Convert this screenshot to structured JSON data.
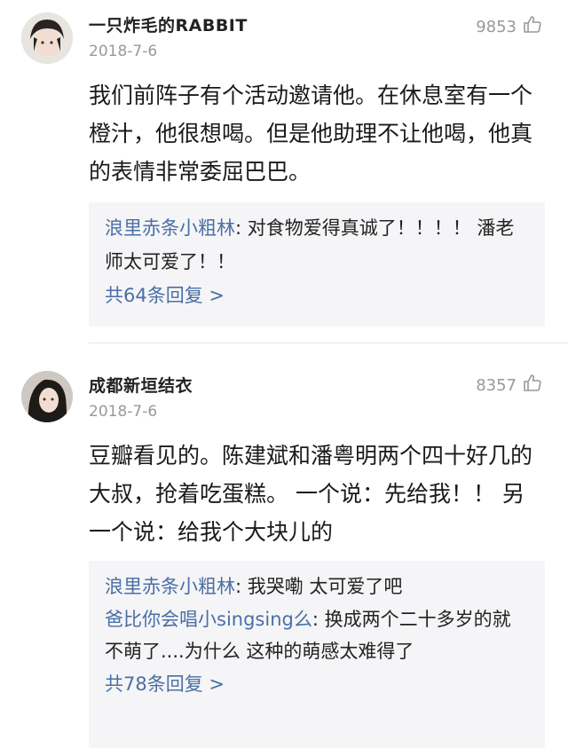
{
  "comments": [
    {
      "username": "一只炸毛的RABBIT",
      "date": "2018-7-6",
      "likes": "9853",
      "text": "我们前阵子有个活动邀请他。在休息室有一个橙汁，他很想喝。但是他助理不让他喝，他真的表情非常委屈巴巴。",
      "replies": [
        {
          "name": "浪里赤条小粗林",
          "text": ": 对食物爱得真诚了！！！！ 潘老师太可爱了！！"
        }
      ],
      "more": "共64条回复 >"
    },
    {
      "username": "成都新垣结衣",
      "date": "2018-7-6",
      "likes": "8357",
      "text": "豆瓣看见的。陈建斌和潘粤明两个四十好几的大叔，抢着吃蛋糕。 一个说：先给我！！ 另一个说：给我个大块儿的",
      "replies": [
        {
          "name": "浪里赤条小粗林",
          "text": ": 我哭嘞 太可爱了吧"
        },
        {
          "name": "爸比你会唱小singsing么",
          "text": ": 换成两个二十多岁的就不萌了....为什么 这种的萌感太难得了"
        }
      ],
      "more": "共78条回复 >"
    }
  ],
  "icons": {
    "like": "thumbs-up-icon",
    "avatar": "avatar"
  },
  "colors": {
    "link": "#4a6fa5",
    "muted": "#999999",
    "reply_bg": "#f5f5f7"
  }
}
